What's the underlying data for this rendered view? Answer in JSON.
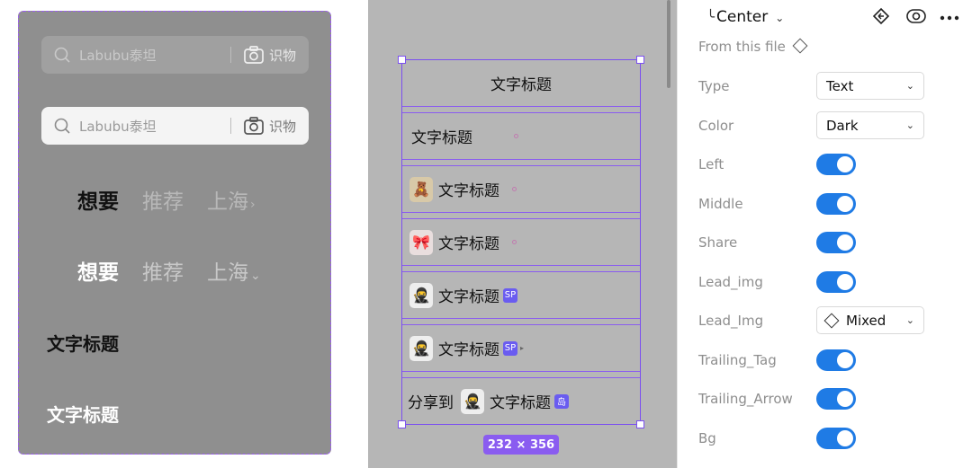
{
  "left_preview": {
    "search_bars": [
      {
        "placeholder": "Labubu泰坦",
        "camera_label": "识物",
        "style": "dim"
      },
      {
        "placeholder": "Labubu泰坦",
        "camera_label": "识物",
        "style": "light"
      }
    ],
    "tab_rows": [
      {
        "tabs": [
          "想要",
          "推荐",
          "上海"
        ],
        "active_index": 0,
        "chevron": "›"
      },
      {
        "tabs": [
          "想要",
          "推荐",
          "上海"
        ],
        "active_index": 0,
        "chevron": "⌄"
      }
    ],
    "titles": [
      "文字标题",
      "文字标题"
    ]
  },
  "canvas": {
    "rows": [
      {
        "text": "文字标题",
        "align": "center"
      },
      {
        "text": "文字标题",
        "dot": true
      },
      {
        "text": "文字标题",
        "avatar": "figurine-avatar",
        "dot": true
      },
      {
        "text": "文字标题",
        "avatar": "doll-avatar",
        "dot": true
      },
      {
        "text": "文字标题",
        "avatar": "ninja-avatar",
        "tag": "SP"
      },
      {
        "text": "文字标题",
        "avatar": "ninja-avatar",
        "tag": "SP",
        "arrow": "▸"
      },
      {
        "prefix": "分享到",
        "text": "文字标题",
        "avatar": "ninja-avatar",
        "tag": "岛"
      }
    ],
    "size_label": "232 × 356"
  },
  "panel": {
    "title": "Center",
    "corner_glyph": "╰",
    "dropdown_glyph": "⌄",
    "from_file": "From this file",
    "properties": [
      {
        "label": "Type",
        "kind": "select",
        "value": "Text"
      },
      {
        "label": "Color",
        "kind": "select",
        "value": "Dark"
      },
      {
        "label": "Left",
        "kind": "toggle",
        "on": true
      },
      {
        "label": "Middle",
        "kind": "toggle",
        "on": true
      },
      {
        "label": "Share",
        "kind": "toggle",
        "on": true
      },
      {
        "label": "Lead_img",
        "kind": "toggle",
        "on": true
      },
      {
        "label": "Lead_Img",
        "kind": "select",
        "value": "Mixed",
        "icon": "diamond-icon"
      },
      {
        "label": "Trailing_Tag",
        "kind": "toggle",
        "on": true
      },
      {
        "label": "Trailing_Arrow",
        "kind": "toggle",
        "on": true
      },
      {
        "label": "Bg",
        "kind": "toggle",
        "on": true
      }
    ],
    "accent_color": "#1f7be5"
  }
}
